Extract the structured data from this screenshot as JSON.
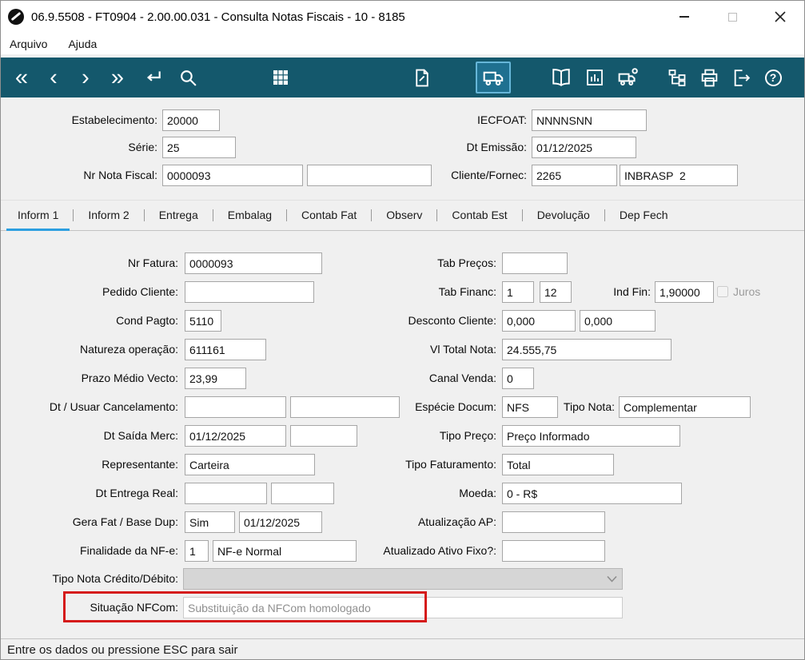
{
  "window": {
    "title": "06.9.5508 - FT0904 - 2.00.00.031 - Consulta Notas Fiscais - 10 - 8185"
  },
  "menu": {
    "items": [
      {
        "label": "Arquivo"
      },
      {
        "label": "Ajuda"
      }
    ]
  },
  "toolbar": {
    "glyphs": {
      "first": "«",
      "prev": "‹",
      "next": "›",
      "last": "»",
      "enter": "↵",
      "help": "?"
    }
  },
  "header": {
    "estabelecimento": {
      "label": "Estabelecimento:",
      "value": "20000"
    },
    "iecfoat": {
      "label": "IECFOAT:",
      "value": "NNNNSNN"
    },
    "serie": {
      "label": "Série:",
      "value": "25"
    },
    "dt_emissao": {
      "label": "Dt Emissão:",
      "value": "01/12/2025"
    },
    "nr_nota_fiscal": {
      "label": "Nr Nota Fiscal:",
      "value": "0000093",
      "value2": ""
    },
    "cliente_fornec": {
      "label": "Cliente/Fornec:",
      "value": "2265",
      "value2": "INBRASP  2"
    }
  },
  "tabs": [
    {
      "label": "Inform 1"
    },
    {
      "label": "Inform 2"
    },
    {
      "label": "Entrega"
    },
    {
      "label": "Embalag"
    },
    {
      "label": "Contab Fat"
    },
    {
      "label": "Observ"
    },
    {
      "label": "Contab Est"
    },
    {
      "label": "Devolução"
    },
    {
      "label": "Dep Fech"
    }
  ],
  "form": {
    "nr_fatura": {
      "label": "Nr Fatura:",
      "value": "0000093"
    },
    "pedido_cliente": {
      "label": "Pedido Cliente:",
      "value": ""
    },
    "cond_pagto": {
      "label": "Cond Pagto:",
      "value": "5110"
    },
    "natureza_operacao": {
      "label": "Natureza operação:",
      "value": "611161"
    },
    "prazo_medio_vecto": {
      "label": "Prazo Médio Vecto:",
      "value": "23,99"
    },
    "dt_usuar_cancelamento": {
      "label": "Dt / Usuar Cancelamento:",
      "value": "",
      "value2": ""
    },
    "dt_saida_merc": {
      "label": "Dt Saída Merc:",
      "value": "01/12/2025",
      "value2": ""
    },
    "representante": {
      "label": "Representante:",
      "value": "Carteira"
    },
    "dt_entrega_real": {
      "label": "Dt Entrega Real:",
      "value": "",
      "value2": ""
    },
    "gera_fat_base_dup": {
      "label": "Gera Fat / Base Dup:",
      "value": "Sim",
      "value2": "01/12/2025"
    },
    "finalidade_nfe": {
      "label": "Finalidade da NF-e:",
      "value": "1",
      "value2": "NF-e Normal"
    },
    "tipo_nota_credito_debito": {
      "label": "Tipo Nota Crédito/Débito:",
      "value": ""
    },
    "situacao_nfcom": {
      "label": "Situação NFCom:",
      "value": "Substituição da NFCom homologado"
    },
    "tab_precos": {
      "label": "Tab Preços:",
      "value": ""
    },
    "tab_financ": {
      "label": "Tab Financ:",
      "value": "1",
      "value2": "12"
    },
    "ind_fin": {
      "label": "Ind Fin:",
      "value": "1,90000"
    },
    "juros": {
      "label": "Juros"
    },
    "desconto_cliente": {
      "label": "Desconto Cliente:",
      "value": "0,000",
      "value2": "0,000"
    },
    "vl_total_nota": {
      "label": "Vl Total Nota:",
      "value": "24.555,75"
    },
    "canal_venda": {
      "label": "Canal Venda:",
      "value": "0"
    },
    "especie_docum": {
      "label": "Espécie Docum:",
      "value": "NFS"
    },
    "tipo_nota": {
      "label": "Tipo Nota:",
      "value": "Complementar"
    },
    "tipo_preco": {
      "label": "Tipo Preço:",
      "value": "Preço Informado"
    },
    "tipo_faturamento": {
      "label": "Tipo Faturamento:",
      "value": "Total"
    },
    "moeda": {
      "label": "Moeda:",
      "value": "0 - R$"
    },
    "atualizacao_ap": {
      "label": "Atualização AP:",
      "value": ""
    },
    "atualizado_ativo_fixo": {
      "label": "Atualizado Ativo Fixo?:",
      "value": ""
    }
  },
  "statusbar": {
    "text": "Entre os dados ou pressione ESC para sair"
  }
}
